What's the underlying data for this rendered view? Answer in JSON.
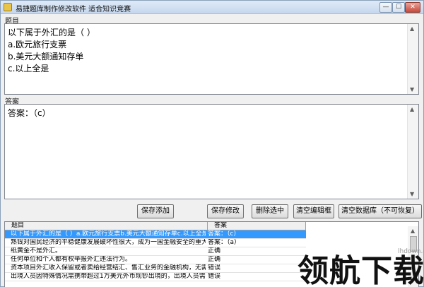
{
  "window": {
    "title": "易捷题库制作修改软件  适合知识竞赛",
    "minimize_glyph": "—",
    "maximize_glyph": "☐",
    "close_glyph": "✕"
  },
  "question_section": {
    "label": "题目",
    "lines": [
      "以下属于外汇的是（  ）",
      "a.欧元旅行支票",
      "b.美元大额通知存单",
      "c.以上全是"
    ]
  },
  "answer_section": {
    "label": "答案",
    "text": "答案：（c）"
  },
  "toolbar": {
    "save_add": "保存添加",
    "save_edit": "保存修改",
    "delete_selected": "删除选中",
    "clear_editor": "清空编辑框",
    "clear_database": "清空数据库（不可恢复）"
  },
  "grid": {
    "headers": [
      "题目",
      "答案"
    ],
    "rows": [
      {
        "question": "以下属于外汇的是（ ）a.欧元旅行支票b.美元大额通知存单c.以上全是",
        "answer": "答案：（c）",
        "selected": true
      },
      {
        "question": "熟钱对国民经济的平稳健康发展破坏性很大，成为一国金融安全的重大隐患",
        "answer": "答案：（a）",
        "selected": false
      },
      {
        "question": "纸黄金不是外汇。",
        "answer": "正确",
        "selected": false
      },
      {
        "question": "任何单位和个人都有权举报外汇违法行为。",
        "answer": "正确",
        "selected": false
      },
      {
        "question": "资本项目外汇收入保留或者卖给经营结汇、售汇业务的金融机构，无需经外汇",
        "answer": "错误",
        "selected": false
      },
      {
        "question": "出境人员因特殊情况需携带超过1万美元外币现钞出境的，出境人员需向银行",
        "answer": "错误",
        "selected": false
      }
    ]
  },
  "scroll_icons": {
    "up": "▲",
    "down": "▼"
  },
  "watermark": {
    "url": "lhdown.com",
    "text": "领航下载"
  }
}
